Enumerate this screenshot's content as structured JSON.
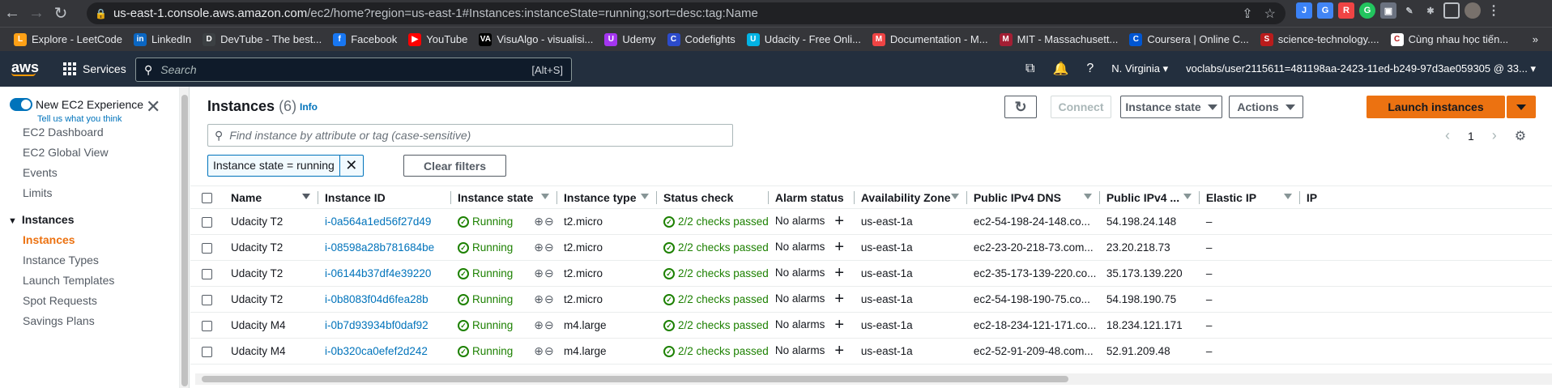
{
  "browser": {
    "url_host": "us-east-1.console.aws.amazon.com",
    "url_path": "/ec2/home?region=us-east-1#Instances:instanceState=running;sort=desc:tag:Name",
    "bookmarks": [
      {
        "label": "Explore - LeetCode",
        "color": "#ffa116",
        "glyph": "L"
      },
      {
        "label": "LinkedIn",
        "color": "#0a66c2",
        "glyph": "in"
      },
      {
        "label": "DevTube - The best...",
        "color": "#3c4043",
        "glyph": "D"
      },
      {
        "label": "Facebook",
        "color": "#1877f2",
        "glyph": "f"
      },
      {
        "label": "YouTube",
        "color": "#ff0000",
        "glyph": "▶"
      },
      {
        "label": "VisuAlgo - visualisi...",
        "color": "#000000",
        "glyph": "VA"
      },
      {
        "label": "Udemy",
        "color": "#a435f0",
        "glyph": "U"
      },
      {
        "label": "Codefights",
        "color": "#2c4bcb",
        "glyph": "C"
      },
      {
        "label": "Udacity - Free Onli...",
        "color": "#02b3e4",
        "glyph": "U"
      },
      {
        "label": "Documentation - M...",
        "color": "#ef4444",
        "glyph": "M"
      },
      {
        "label": "MIT - Massachusett...",
        "color": "#a31f34",
        "glyph": "M"
      },
      {
        "label": "Coursera | Online C...",
        "color": "#0056d2",
        "glyph": "C"
      },
      {
        "label": "science-technology....",
        "color": "#b91c1c",
        "glyph": "S"
      },
      {
        "label": "Cùng nhau học tiến...",
        "color": "#ffffff",
        "glyph": "C"
      }
    ]
  },
  "aws_header": {
    "logo": "aws",
    "services": "Services",
    "search_placeholder": "Search",
    "search_shortcut": "[Alt+S]",
    "region": "N. Virginia",
    "account": "voclabs/user2115611=481198aa-2423-11ed-b249-97d3ae059305 @ 33..."
  },
  "sidebar": {
    "new_experience": "New EC2 Experience",
    "tell_us": "Tell us what you think",
    "items": [
      "EC2 Dashboard",
      "EC2 Global View",
      "Events",
      "Limits"
    ],
    "section": "Instances",
    "sub_items": [
      "Instances",
      "Instance Types",
      "Launch Templates",
      "Spot Requests",
      "Savings Plans"
    ]
  },
  "main": {
    "title": "Instances",
    "count": "(6)",
    "info": "Info",
    "buttons": {
      "connect": "Connect",
      "instance_state": "Instance state",
      "actions": "Actions",
      "launch": "Launch instances"
    },
    "search_placeholder": "Find instance by attribute or tag (case-sensitive)",
    "page": "1",
    "filter_token": "Instance state = running",
    "clear_filters": "Clear filters"
  },
  "table": {
    "headers": [
      "Name",
      "Instance ID",
      "Instance state",
      "Instance type",
      "Status check",
      "Alarm status",
      "Availability Zone",
      "Public IPv4 DNS",
      "Public IPv4 ...",
      "Elastic IP",
      "IP"
    ],
    "rows": [
      {
        "name": "Udacity T2",
        "id": "i-0a564a1ed56f27d49",
        "state": "Running",
        "type": "t2.micro",
        "status": "2/2 checks passed",
        "alarm": "No alarms",
        "az": "us-east-1a",
        "dns": "ec2-54-198-24-148.co...",
        "ip": "54.198.24.148",
        "eip": "–"
      },
      {
        "name": "Udacity T2",
        "id": "i-08598a28b781684be",
        "state": "Running",
        "type": "t2.micro",
        "status": "2/2 checks passed",
        "alarm": "No alarms",
        "az": "us-east-1a",
        "dns": "ec2-23-20-218-73.com...",
        "ip": "23.20.218.73",
        "eip": "–"
      },
      {
        "name": "Udacity T2",
        "id": "i-06144b37df4e39220",
        "state": "Running",
        "type": "t2.micro",
        "status": "2/2 checks passed",
        "alarm": "No alarms",
        "az": "us-east-1a",
        "dns": "ec2-35-173-139-220.co...",
        "ip": "35.173.139.220",
        "eip": "–"
      },
      {
        "name": "Udacity T2",
        "id": "i-0b8083f04d6fea28b",
        "state": "Running",
        "type": "t2.micro",
        "status": "2/2 checks passed",
        "alarm": "No alarms",
        "az": "us-east-1a",
        "dns": "ec2-54-198-190-75.co...",
        "ip": "54.198.190.75",
        "eip": "–"
      },
      {
        "name": "Udacity M4",
        "id": "i-0b7d93934bf0daf92",
        "state": "Running",
        "type": "m4.large",
        "status": "2/2 checks passed",
        "alarm": "No alarms",
        "az": "us-east-1a",
        "dns": "ec2-18-234-121-171.co...",
        "ip": "18.234.121.171",
        "eip": "–"
      },
      {
        "name": "Udacity M4",
        "id": "i-0b320ca0efef2d242",
        "state": "Running",
        "type": "m4.large",
        "status": "2/2 checks passed",
        "alarm": "No alarms",
        "az": "us-east-1a",
        "dns": "ec2-52-91-209-48.com...",
        "ip": "52.91.209.48",
        "eip": "–"
      }
    ]
  }
}
